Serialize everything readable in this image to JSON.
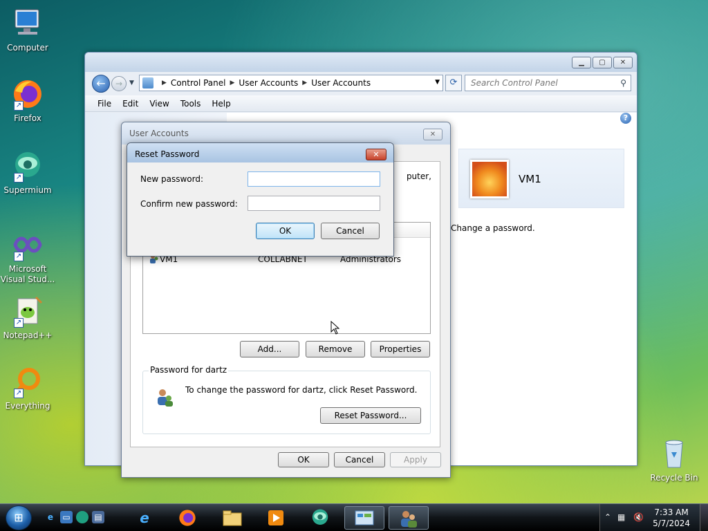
{
  "desktop": {
    "icons": [
      {
        "label": "Computer"
      },
      {
        "label": "Firefox"
      },
      {
        "label": "Supermium"
      },
      {
        "label": "Microsoft Visual Stud..."
      },
      {
        "label": "Notepad++"
      },
      {
        "label": "Everything"
      },
      {
        "label": "Recycle Bin"
      }
    ]
  },
  "control_panel": {
    "breadcrumb": [
      "Control Panel",
      "User Accounts",
      "User Accounts"
    ],
    "search_placeholder": "Search Control Panel",
    "menu": [
      "File",
      "Edit",
      "View",
      "Tools",
      "Help"
    ],
    "user_tile_name": "VM1",
    "change_password_link": "Change a password."
  },
  "user_accounts_dialog": {
    "title": "User Accounts",
    "description_fragment": "puter,",
    "list_row": {
      "name": "VM1",
      "domain": "COLLABNET",
      "group": "Administrators"
    },
    "buttons": {
      "add": "Add...",
      "remove": "Remove",
      "properties": "Properties"
    },
    "password_group": {
      "label": "Password for dartz",
      "text": "To change the password for dartz, click Reset Password.",
      "reset_button": "Reset Password..."
    },
    "footer": {
      "ok": "OK",
      "cancel": "Cancel",
      "apply": "Apply"
    }
  },
  "reset_password_dialog": {
    "title": "Reset Password",
    "new_password_label": "New password:",
    "confirm_password_label": "Confirm new password:",
    "new_password_value": "",
    "confirm_password_value": "",
    "ok": "OK",
    "cancel": "Cancel"
  },
  "taskbar": {
    "clock_time": "7:33 AM",
    "clock_date": "5/7/2024"
  }
}
